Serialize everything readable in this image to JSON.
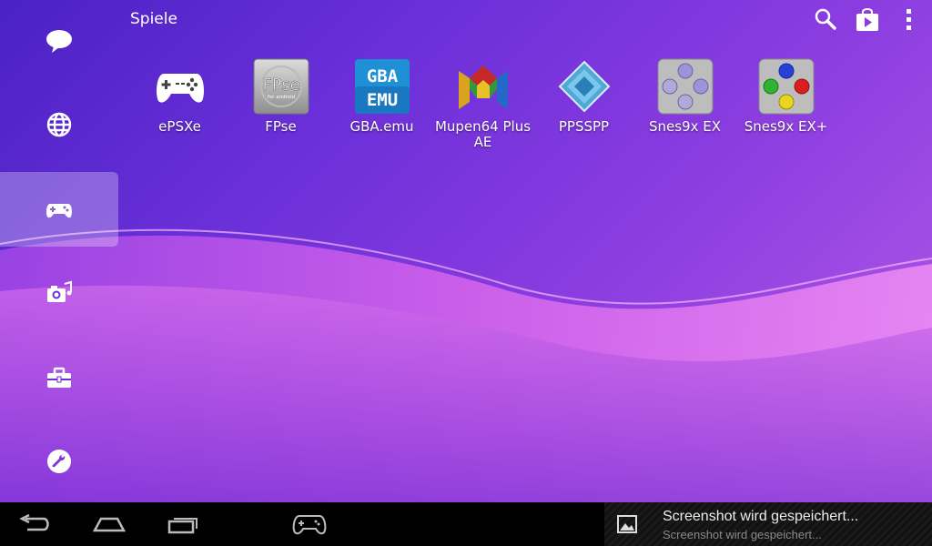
{
  "header": {
    "title": "Spiele",
    "actions": [
      {
        "icon": "search-icon"
      },
      {
        "icon": "play-store-icon"
      },
      {
        "icon": "overflow-menu-icon"
      }
    ]
  },
  "dock": {
    "items": [
      {
        "icon": "chat-icon",
        "active": false
      },
      {
        "icon": "globe-icon",
        "active": false
      },
      {
        "icon": "gamepad-icon",
        "active": true
      },
      {
        "icon": "media-icon",
        "active": false
      },
      {
        "icon": "toolbox-icon",
        "active": false
      },
      {
        "icon": "wrench-icon",
        "active": false
      }
    ]
  },
  "apps": [
    {
      "label": "ePSXe",
      "icon": "epsxe-icon"
    },
    {
      "label": "FPse",
      "icon": "fpse-icon",
      "icon_text": "FPse",
      "icon_subtext": "for android"
    },
    {
      "label": "GBA.emu",
      "icon": "gbaemu-icon",
      "icon_text_top": "GBA",
      "icon_text_bottom": "EMU"
    },
    {
      "label": "Mupen64 Plus AE",
      "icon": "mupen64-icon"
    },
    {
      "label": "PPSSPP",
      "icon": "ppsspp-icon"
    },
    {
      "label": "Snes9x EX",
      "icon": "snes9x-icon"
    },
    {
      "label": "Snes9x EX+",
      "icon": "snes9x-plus-icon"
    }
  ],
  "system_bar": {
    "buttons": [
      {
        "icon": "back-icon"
      },
      {
        "icon": "home-icon"
      },
      {
        "icon": "recents-icon"
      },
      {
        "icon": "gamepad-icon"
      }
    ],
    "notification": {
      "icon": "image-icon",
      "title": "Screenshot wird gespeichert...",
      "subtitle": "Screenshot wird gespeichert..."
    }
  },
  "colors": {
    "background_start": "#4a22c4",
    "background_end": "#b45be8",
    "wave": "#e66ff0",
    "system_bar": "#000000"
  }
}
